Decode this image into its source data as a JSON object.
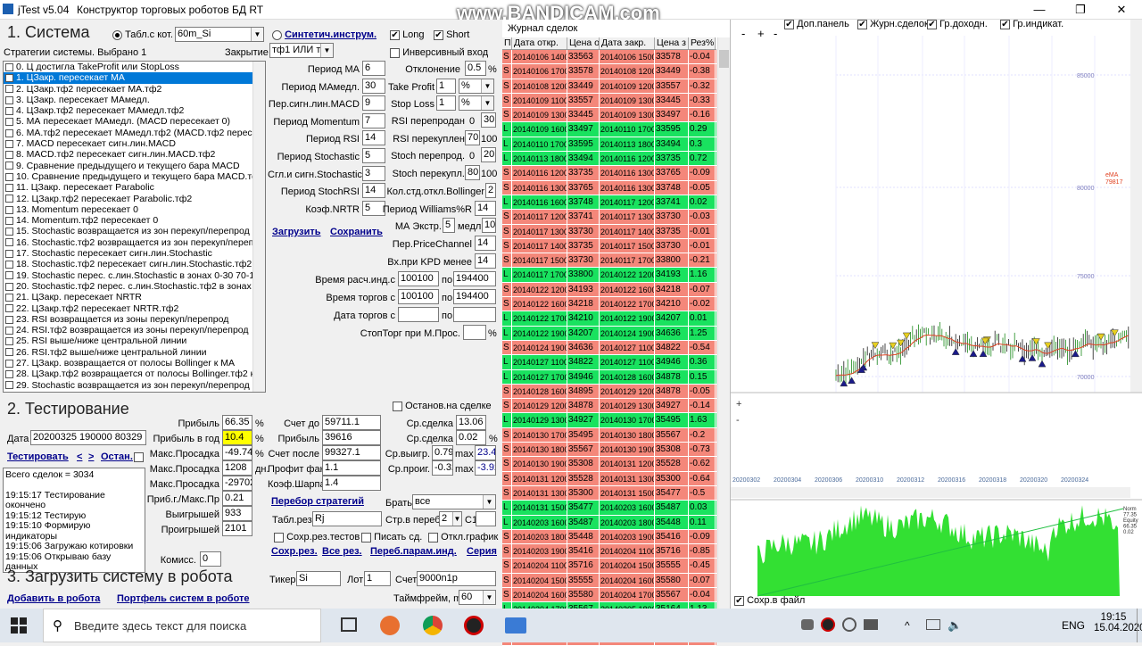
{
  "window": {
    "app_title": "jTest v5.04",
    "menu": [
      "Конструктор торговых роботов",
      "БД RT"
    ],
    "watermark": "www.BANDICAM.com"
  },
  "system": {
    "heading": "1. Система",
    "radio_table_label": "Табл.с кот.",
    "timeframe_select": "60m_Si",
    "radio_synth_label": "Синтетич.инструм.",
    "long_label": "Long",
    "short_label": "Short",
    "inverse_label": "Инверсивный вход",
    "strategies_label": "Стратегии системы. Выбрано 1",
    "close_label": "Закрытие",
    "close_select": "тф1 ИЛИ тф",
    "strategies": [
      "0. Ц достигла TakeProfit или StopLoss",
      "1. ЦЗакр. пересекает МА",
      "2. ЦЗакр.тф2 пересекает МА.тф2",
      "3. ЦЗакр. пересекает МАмедл.",
      "4. ЦЗакр.тф2 пересекает МАмедл.тф2",
      "5. МА пересекает МАмедл. (MACD пересекает 0)",
      "6. МА.тф2 пересекает МАмедл.тф2 (MACD.тф2 пересе",
      "7. MACD пересекает сигн.лин.MACD",
      "8. MACD.тф2 пересекает сигн.лин.MACD.тф2",
      "9. Сравнение предыдущего и текущего бара MACD",
      "10. Сравнение предыдущего и текущего бара MACD.тф",
      "11. ЦЗакр. пересекает Parabolic",
      "12. ЦЗакр.тф2 пересекает Parabolic.тф2",
      "13. Momentum пересекает 0",
      "14. Momentum.тф2 пересекает 0",
      "15. Stochastic возвращается из зон перекуп/перепрод",
      "16. Stochastic.тф2 возвращается из зон перекуп/переп",
      "17. Stochastic пересекает сигн.лин.Stochastic",
      "18. Stochastic.тф2 пересекает сигн.лин.Stochastic.тф2",
      "19. Stochastic перес. с.лин.Stochastic в зонах 0-30 70-10",
      "20. Stochastic.тф2 перес. с.лин.Stochastic.тф2 в зонах 0",
      "21. ЦЗакр. пересекает NRTR",
      "22. ЦЗакр.тф2 пересекает NRTR.тф2",
      "23. RSI возвращается из зоны перекуп/перепрод",
      "24. RSI.тф2 возвращается из зоны перекуп/перепрод",
      "25. RSI выше/ниже центральной линии",
      "26. RSI.тф2 выше/ниже центральной линии",
      "27. ЦЗакр. возвращается от полосы Bollinger к МА",
      "28. ЦЗакр.тф2 возвращается от полосы Bollinger.тф2 к",
      "29. Stochastic возвращается из зон перекуп/перепрод",
      "30. StochRSI.тф2 возвращается из зон перекуп/перепрод"
    ],
    "params_mid": [
      {
        "label": "Период МА",
        "value": "6"
      },
      {
        "label": "Период МАмедл.",
        "value": "30"
      },
      {
        "label": "Пер.сигн.лин.MACD",
        "value": "9"
      },
      {
        "label": "Период Momentum",
        "value": "7"
      },
      {
        "label": "Период RSI",
        "value": "14"
      },
      {
        "label": "Период Stochastic",
        "value": "5"
      },
      {
        "label": "Сгл.и сигн.Stochastic",
        "value": "3"
      },
      {
        "label": "Период StochRSI",
        "value": "14"
      },
      {
        "label": "Коэф.NRTR",
        "value": "5"
      }
    ],
    "deviation_label": "Отклонение",
    "deviation_value": "0.5",
    "deviation_unit": "%",
    "take_profit_label": "Take Profit",
    "take_profit_value": "1",
    "take_profit_unit": "%",
    "stop_loss_label": "Stop Loss",
    "stop_loss_value": "1",
    "stop_loss_unit": "%",
    "rsi_oversold_label": "RSI перепродан",
    "rsi_oversold_a": "0",
    "rsi_oversold_b": "30",
    "rsi_overbought_label": "RSI перекуплен",
    "rsi_overbought_a": "70",
    "rsi_overbought_b": "100",
    "stoch_oversold_label": "Stoch перепрод.",
    "stoch_oversold_a": "0",
    "stoch_oversold_b": "20",
    "stoch_overbought_label": "Stoch перекупл.",
    "stoch_overbought_a": "80",
    "stoch_overbought_b": "100",
    "bollinger_label": "Кол.стд.откл.Bollinger",
    "bollinger_value": "2",
    "williams_label": "Период Williams%R",
    "williams_value": "14",
    "ma_extr_label": "МА Экстр.",
    "ma_extr_value": "5",
    "slow_label": "медл.",
    "slow_value": "10",
    "price_channel_label": "Пер.PriceChannel",
    "price_channel_value": "14",
    "kpd_label": "Вх.при KPD менее",
    "kpd_value": "14",
    "load_link": "Загрузить",
    "save_link": "Сохранить",
    "calc_time_label": "Время расч.инд.с",
    "calc_from": "100100",
    "calc_to_label": "по",
    "calc_to": "194400",
    "trade_time_label": "Время торгов с",
    "trade_from": "100100",
    "trade_to_label": "по",
    "trade_to": "194400",
    "date_label": "Дата торгов с",
    "date_from": "",
    "date_to_label": "по",
    "date_to": "",
    "stop_trade_label": "СтопТорг при М.Прос.",
    "stop_trade_value": "",
    "stop_trade_unit": "%"
  },
  "testing": {
    "heading": "2. Тестирование",
    "stop_on_trade_label": "Останов.на сделке",
    "date_label": "Дата",
    "date_value": "20200325 190000 80329",
    "test_link": "Тестировать",
    "prev": "<",
    "next": ">",
    "stop_link": "Остан.",
    "log": [
      "Всего сделок = 3034",
      "",
      "19:15:17 Тестирование окончено",
      "19:15:12 Тестирую",
      "19:15:10 Формирую индикаторы",
      "19:15:06 Загружаю котировки",
      "19:15:06 Открываю базу данных"
    ],
    "profit_label": "Прибыль",
    "profit_value": "66.35",
    "profit_unit": "%",
    "profit_year_label": "Прибыль в год",
    "profit_year_value": "10.4",
    "profit_year_unit": "%",
    "max_dd_label": "Макс.Просадка",
    "max_dd_value": "-49.74",
    "max_dd_unit": "%",
    "max_dd2_label": "Макс.Просадка",
    "max_dd2_value": "1208",
    "max_dd2_unit": "дн.",
    "max_dd3_label": "Макс.Просадка",
    "max_dd3_value": "-29702",
    "prof_dd_label": "Приб.г./Макс.Пр",
    "prof_dd_value": "0.21",
    "wins_label": "Выигрышей",
    "wins_value": "933",
    "losses_label": "Проигрышей",
    "losses_value": "2101",
    "commission_label": "Комисс.",
    "commission_value": "0",
    "acc_before_label": "Счет до",
    "acc_before_value": "59711.1",
    "profit2_label": "Прибыль",
    "profit2_value": "39616",
    "acc_after_label": "Счет после",
    "acc_after_value": "99327.1",
    "pf_label": "Профит фактор",
    "pf_value": "1.1",
    "sharpe_label": "Коэф.Шарпа",
    "sharpe_value": "1.4",
    "avg_trade_label": "Ср.сделка",
    "avg_trade_value": "13.06",
    "avg_trade2_label": "Ср.сделка",
    "avg_trade2_value": "0.02",
    "avg_trade2_unit": "%",
    "avg_win_label": "Ср.выигр.",
    "avg_win_value": "0.79",
    "avg_win_max_label": "max",
    "avg_win_max": "23.42",
    "avg_loss_label": "Ср.проиг.",
    "avg_loss_value": "-0.32",
    "avg_loss_max_label": "max",
    "avg_loss_max": "-3.92",
    "enum_link": "Перебор стратегий",
    "take_label": "Брать",
    "take_select": "все",
    "table_res_label": "Табл.рез.",
    "table_res_value": "Rj",
    "str_label": "Стр.в переб",
    "str_select": "2",
    "c1_label": "С1",
    "c1_value": "",
    "save_tests_label": "Сохр.рез.тестов",
    "write_label": "Писать сд.",
    "off_graph_label": "Откл.график",
    "save_res_link": "Сохр.рез.",
    "all_res_link": "Все рез.",
    "enum_params_link": "Переб.парам.инд.",
    "series_link": "Серия"
  },
  "robot": {
    "heading": "3. Загрузить систему в робота",
    "add_link": "Добавить в робота",
    "portfolio_link": "Портфель систем в роботе",
    "ticker_label": "Тикер",
    "ticker_value": "Si",
    "lot_label": "Лот",
    "lot_value": "1",
    "account_label": "Счет",
    "account_value": "9000n1p",
    "timeframe_label": "Таймфрейм, m",
    "timeframe_value": "60"
  },
  "journal": {
    "title": "Журнал сделок",
    "headers": [
      "П",
      "Дата откр.",
      "Цена о",
      "Дата закр.",
      "Цена з",
      "Рез%"
    ],
    "rows": [
      [
        "S",
        "20140106 1400",
        "33563",
        "20140106 1500",
        "33578",
        "-0.04"
      ],
      [
        "S",
        "20140106 1700",
        "33578",
        "20140108 1200",
        "33449",
        "-0.38"
      ],
      [
        "S",
        "20140108 1200",
        "33449",
        "20140109 1200",
        "33557",
        "-0.32"
      ],
      [
        "S",
        "20140109 1100",
        "33557",
        "20140109 1300",
        "33445",
        "-0.33"
      ],
      [
        "S",
        "20140109 1300",
        "33445",
        "20140109 1300",
        "33497",
        "-0.16"
      ],
      [
        "L",
        "20140109 1600",
        "33497",
        "20140110 1700",
        "33595",
        "0.29"
      ],
      [
        "L",
        "20140110 1700",
        "33595",
        "20140113 1800",
        "33494",
        "0.3"
      ],
      [
        "L",
        "20140113 1800",
        "33494",
        "20140116 1200",
        "33735",
        "0.72"
      ],
      [
        "S",
        "20140116 1200",
        "33735",
        "20140116 1300",
        "33765",
        "-0.09"
      ],
      [
        "S",
        "20140116 1300",
        "33765",
        "20140116 1300",
        "33748",
        "-0.05"
      ],
      [
        "L",
        "20140116 1600",
        "33748",
        "20140117 1200",
        "33741",
        "0.02"
      ],
      [
        "S",
        "20140117 1200",
        "33741",
        "20140117 1300",
        "33730",
        "-0.03"
      ],
      [
        "S",
        "20140117 1300",
        "33730",
        "20140117 1400",
        "33735",
        "-0.01"
      ],
      [
        "S",
        "20140117 1400",
        "33735",
        "20140117 1500",
        "33730",
        "-0.01"
      ],
      [
        "S",
        "20140117 1500",
        "33730",
        "20140117 1700",
        "33800",
        "-0.21"
      ],
      [
        "L",
        "20140117 1700",
        "33800",
        "20140122 1200",
        "34193",
        "1.16"
      ],
      [
        "S",
        "20140122 1200",
        "34193",
        "20140122 1600",
        "34218",
        "-0.07"
      ],
      [
        "S",
        "20140122 1600",
        "34218",
        "20140122 1700",
        "34210",
        "-0.02"
      ],
      [
        "L",
        "20140122 1700",
        "34210",
        "20140122 1900",
        "34207",
        "0.01"
      ],
      [
        "L",
        "20140122 1900",
        "34207",
        "20140124 1900",
        "34636",
        "1.25"
      ],
      [
        "S",
        "20140124 1900",
        "34636",
        "20140127 1100",
        "34822",
        "-0.54"
      ],
      [
        "L",
        "20140127 1100",
        "34822",
        "20140127 1100",
        "34946",
        "0.36"
      ],
      [
        "L",
        "20140127 1700",
        "34946",
        "20140128 1600",
        "34878",
        "0.15"
      ],
      [
        "S",
        "20140128 1600",
        "34895",
        "20140129 1200",
        "34878",
        "-0.05"
      ],
      [
        "S",
        "20140129 1200",
        "34878",
        "20140129 1300",
        "34927",
        "-0.14"
      ],
      [
        "L",
        "20140129 1300",
        "34927",
        "20140130 1700",
        "35495",
        "1.63"
      ],
      [
        "S",
        "20140130 1700",
        "35495",
        "20140130 1800",
        "35567",
        "-0.2"
      ],
      [
        "S",
        "20140130 1800",
        "35567",
        "20140130 1900",
        "35308",
        "-0.73"
      ],
      [
        "S",
        "20140130 1900",
        "35308",
        "20140131 1200",
        "35528",
        "-0.62"
      ],
      [
        "S",
        "20140131 1200",
        "35528",
        "20140131 1300",
        "35300",
        "-0.64"
      ],
      [
        "S",
        "20140131 1300",
        "35300",
        "20140131 1500",
        "35477",
        "-0.5"
      ],
      [
        "L",
        "20140131 1500",
        "35477",
        "20140203 1600",
        "35487",
        "0.03"
      ],
      [
        "L",
        "20140203 1600",
        "35487",
        "20140203 1800",
        "35448",
        "0.11"
      ],
      [
        "S",
        "20140203 1800",
        "35448",
        "20140203 1900",
        "35416",
        "-0.09"
      ],
      [
        "S",
        "20140203 1900",
        "35416",
        "20140204 1100",
        "35716",
        "-0.85"
      ],
      [
        "S",
        "20140204 1100",
        "35716",
        "20140204 1500",
        "35555",
        "-0.45"
      ],
      [
        "S",
        "20140204 1500",
        "35555",
        "20140204 1600",
        "35580",
        "-0.07"
      ],
      [
        "S",
        "20140204 1600",
        "35580",
        "20140204 1700",
        "35567",
        "-0.04"
      ],
      [
        "L",
        "20140204 1700",
        "35567",
        "20140205 1800",
        "35164",
        "1.13"
      ],
      [
        "S",
        "20140205 1800",
        "35164",
        "20140205 1900",
        "35088",
        "-0.22"
      ],
      [
        "S",
        "20140205 1900",
        "35088",
        "20140206 1800",
        "35088",
        "0.23"
      ]
    ]
  },
  "chart": {
    "toolbar": [
      "Доп.панель",
      "Журн.сделок",
      "Гр.доходн.",
      "Гр.индикат."
    ],
    "price_ticks": [
      "85000",
      "80000",
      "75000",
      "70000"
    ],
    "ema_label": "eMA",
    "ema_value": "79817",
    "date_ticks": [
      "20200302",
      "20200304",
      "20200306",
      "20200310",
      "20200312",
      "20200316",
      "20200318",
      "20200320",
      "20200324"
    ],
    "equity_labels": [
      "Norm",
      "77.35",
      "Equity",
      "66.35",
      "0.02"
    ],
    "save_file_label": "Сохр.в файл"
  },
  "taskbar": {
    "search_placeholder": "Введите здесь текст для поиска",
    "lang": "ENG",
    "time": "19:15",
    "date": "15.04.2020"
  }
}
